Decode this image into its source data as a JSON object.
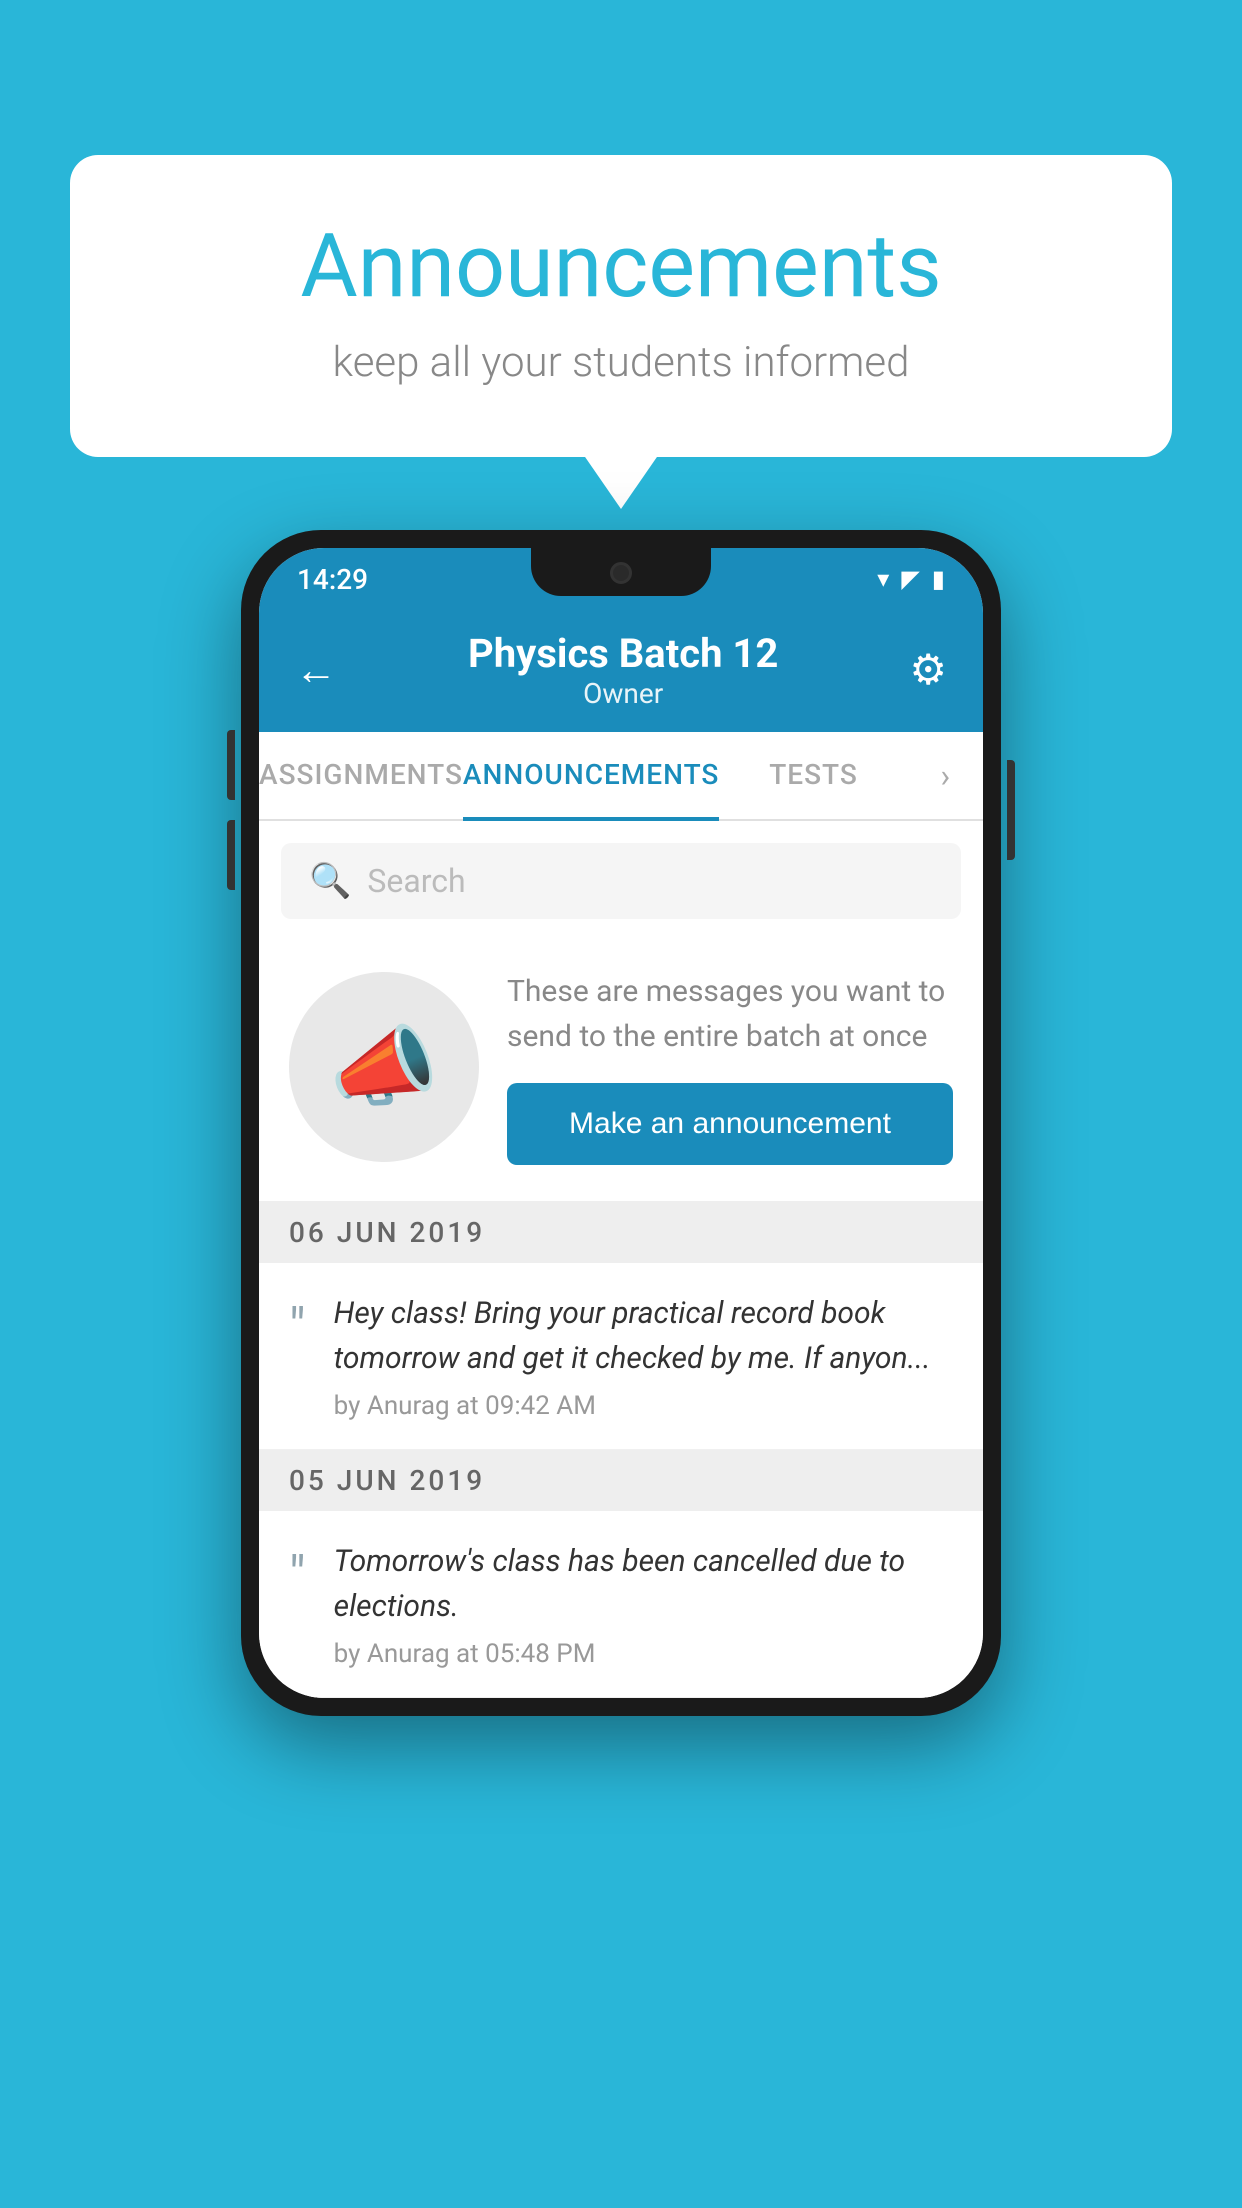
{
  "background_color": "#29b6d8",
  "speech_bubble": {
    "title": "Announcements",
    "subtitle": "keep all your students informed"
  },
  "phone": {
    "status_bar": {
      "time": "14:29",
      "wifi": "▾",
      "signal": "▲",
      "battery": "▮"
    },
    "header": {
      "back_label": "←",
      "title": "Physics Batch 12",
      "subtitle": "Owner",
      "settings_label": "⚙"
    },
    "tabs": [
      {
        "label": "ASSIGNMENTS",
        "active": false
      },
      {
        "label": "ANNOUNCEMENTS",
        "active": true
      },
      {
        "label": "TESTS",
        "active": false
      }
    ],
    "search": {
      "placeholder": "Search"
    },
    "announcement_prompt": {
      "description": "These are messages you want to send to the entire batch at once",
      "button_label": "Make an announcement"
    },
    "announcements": [
      {
        "date": "06  JUN  2019",
        "text": "Hey class! Bring your practical record book tomorrow and get it checked by me. If anyon...",
        "meta": "by Anurag at 09:42 AM"
      },
      {
        "date": "05  JUN  2019",
        "text": "Tomorrow's class has been cancelled due to elections.",
        "meta": "by Anurag at 05:48 PM"
      }
    ]
  }
}
